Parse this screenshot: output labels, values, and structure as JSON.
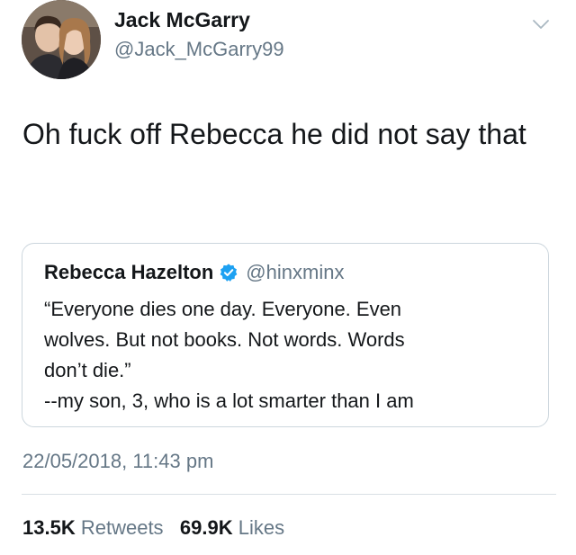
{
  "tweet": {
    "author": {
      "name": "Jack McGarry",
      "handle": "@Jack_McGarry99"
    },
    "text": "Oh fuck off Rebecca he did not say that",
    "timestamp": "22/05/2018, 11:43 pm",
    "stats": {
      "retweets_count": "13.5K",
      "retweets_label": "Retweets",
      "likes_count": "69.9K",
      "likes_label": "Likes"
    }
  },
  "quoted_tweet": {
    "author": {
      "name": "Rebecca Hazelton",
      "handle": "@hinxminx",
      "verified": true
    },
    "lines": [
      "“Everyone dies one day. Everyone. Even",
      "wolves. But not books. Not words. Words",
      "don’t die.”",
      "--my son, 3, who is a lot smarter than I am"
    ]
  },
  "colors": {
    "text_primary": "#14171a",
    "text_secondary": "#657786",
    "border": "#ccd6dd",
    "verified_badge": "#1da1f2"
  },
  "icons": {
    "menu": "chevron-down-icon",
    "verified": "verified-badge-icon"
  }
}
